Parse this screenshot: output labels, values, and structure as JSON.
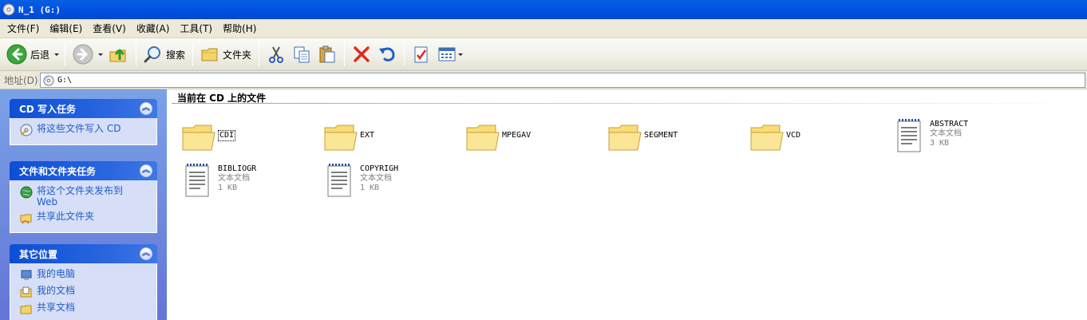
{
  "window": {
    "title": "N_1 (G:)"
  },
  "menu": [
    "文件(F)",
    "编辑(E)",
    "查看(V)",
    "收藏(A)",
    "工具(T)",
    "帮助(H)"
  ],
  "toolbar": {
    "back_label": "后退",
    "search_label": "搜索",
    "folders_label": "文件夹"
  },
  "address": {
    "label": "地址(D)",
    "value": "G:\\"
  },
  "sidebar": {
    "cd_tasks": {
      "title": "CD 写入任务",
      "items": [
        "将这些文件写入 CD"
      ]
    },
    "file_tasks": {
      "title": "文件和文件夹任务",
      "items": [
        "将这个文件夹发布到 Web",
        "共享此文件夹"
      ]
    },
    "other_places": {
      "title": "其它位置",
      "items": [
        "我的电脑",
        "我的文档",
        "共享文档"
      ]
    }
  },
  "content": {
    "group_title": "当前在 CD 上的文件",
    "items": [
      {
        "name": "CDI",
        "kind": "folder"
      },
      {
        "name": "EXT",
        "kind": "folder"
      },
      {
        "name": "MPEGAV",
        "kind": "folder"
      },
      {
        "name": "SEGMENT",
        "kind": "folder"
      },
      {
        "name": "VCD",
        "kind": "folder"
      },
      {
        "name": "ABSTRACT",
        "kind": "text",
        "type": "文本文档",
        "size": "3 KB"
      },
      {
        "name": "BIBLIOGR",
        "kind": "text",
        "type": "文本文档",
        "size": "1 KB"
      },
      {
        "name": "COPYRIGH",
        "kind": "text",
        "type": "文本文档",
        "size": "1 KB"
      }
    ]
  }
}
